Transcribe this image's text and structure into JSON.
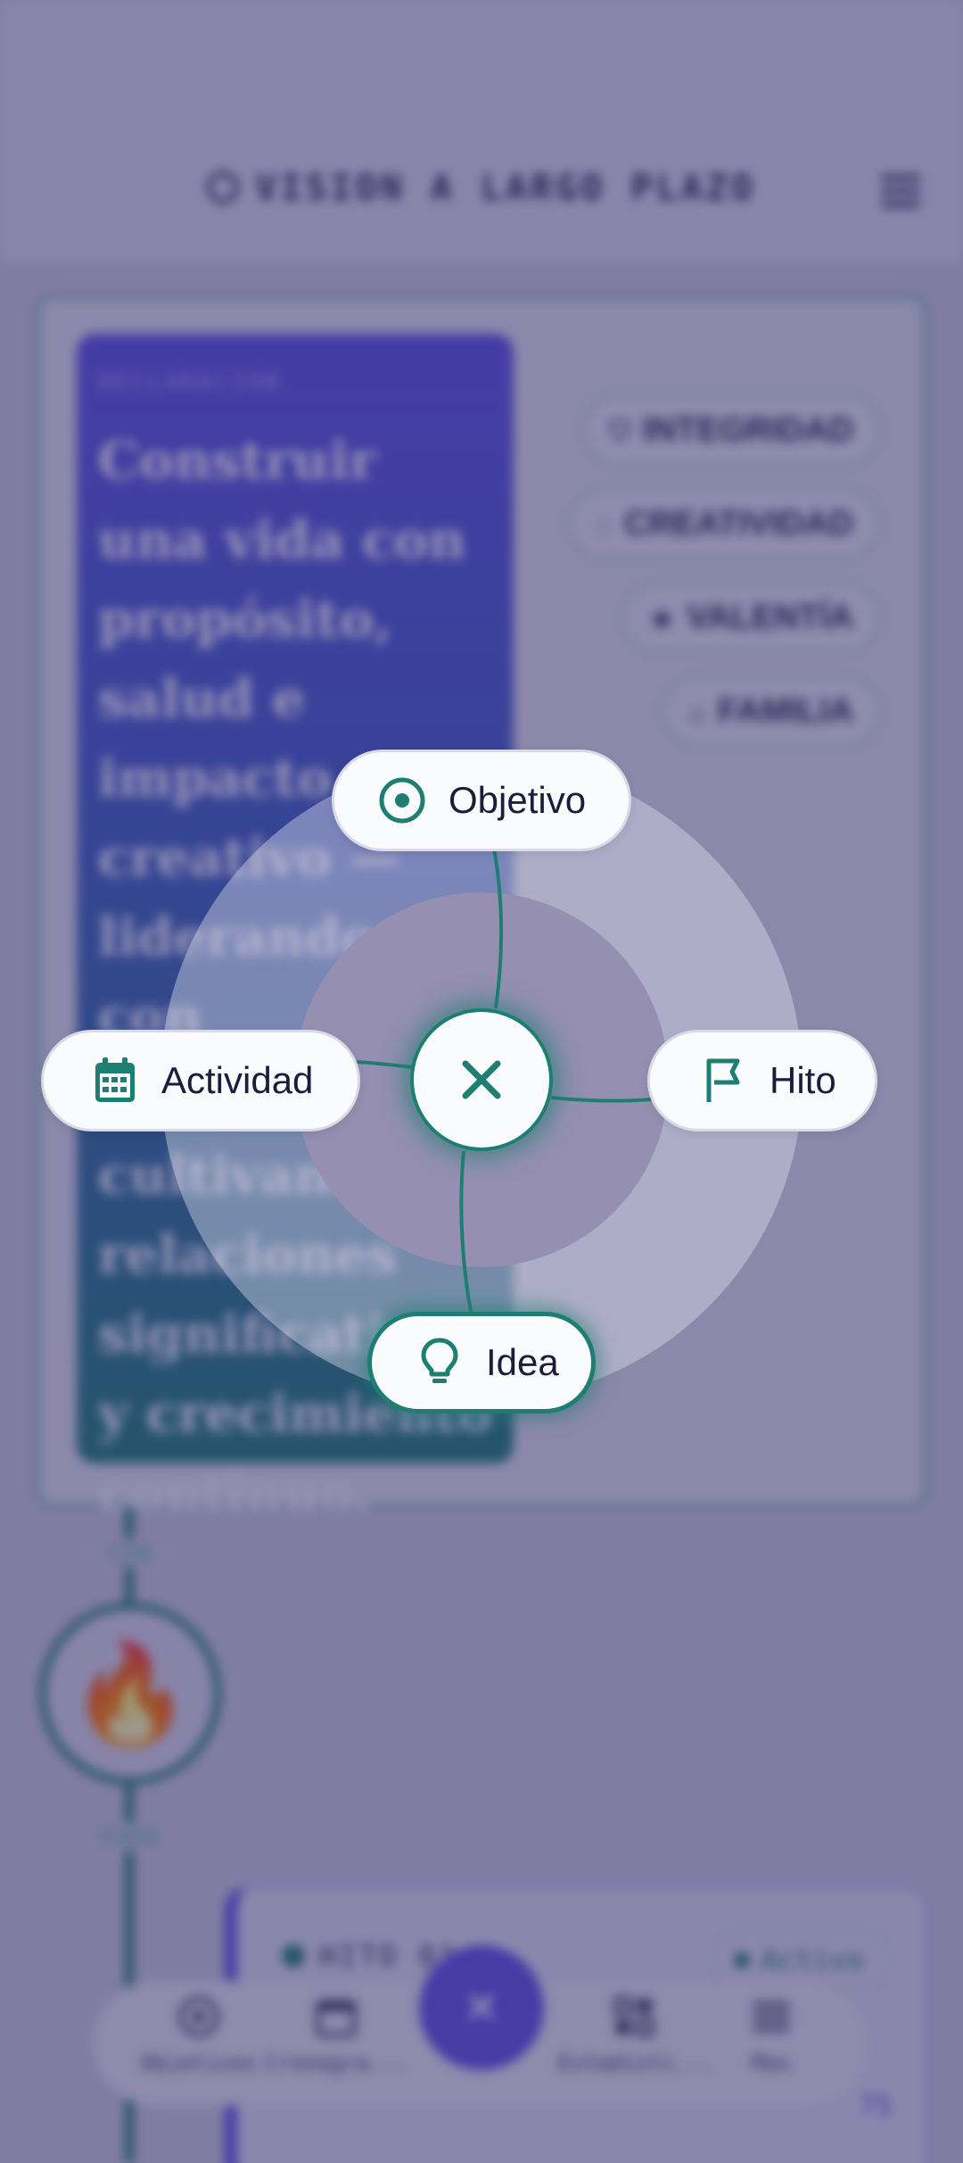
{
  "header": {
    "title": "VISION A LARGO PLAZO"
  },
  "vision": {
    "declaration_label": "DECLARACION",
    "declaration_text": "Construir una vida con propósito, salud e impacto creativo — liderando con integridad, cultivando relaciones significativas y crecimiento continuo.",
    "values": [
      {
        "label": "INTEGRIDAD",
        "icon": "shield-icon"
      },
      {
        "label": "CREATIVIDAD",
        "icon": "palette-icon"
      },
      {
        "label": "VALENTÍA",
        "icon": "star-icon"
      },
      {
        "label": "FAMILIA",
        "icon": "home-icon"
      }
    ]
  },
  "timeline": {
    "label_con": "CON",
    "label_para": "PARA",
    "milestone": {
      "label": "HITO 01",
      "status": "Activo",
      "count": "75"
    }
  },
  "bottom_nav": {
    "items": [
      {
        "label": "Objetivos",
        "icon": "target-icon"
      },
      {
        "label": "Cronogra...",
        "icon": "calendar-icon"
      },
      {
        "label": "Estadísti...",
        "icon": "stats-icon"
      },
      {
        "label": "Mas",
        "icon": "menu-icon"
      }
    ],
    "fab_icon": "close-icon"
  },
  "radial_menu": {
    "items": [
      {
        "label": "Objetivo",
        "icon": "target-icon"
      },
      {
        "label": "Actividad",
        "icon": "calendar-icon"
      },
      {
        "label": "Hito",
        "icon": "flag-icon"
      },
      {
        "label": "Idea",
        "icon": "lightbulb-icon"
      }
    ],
    "close_icon": "close-icon"
  },
  "colors": {
    "accent_teal": "#1f7e72",
    "accent_purple": "#5b50e0",
    "scrim": "#2c2662",
    "text_dark": "#1e1b3c"
  }
}
